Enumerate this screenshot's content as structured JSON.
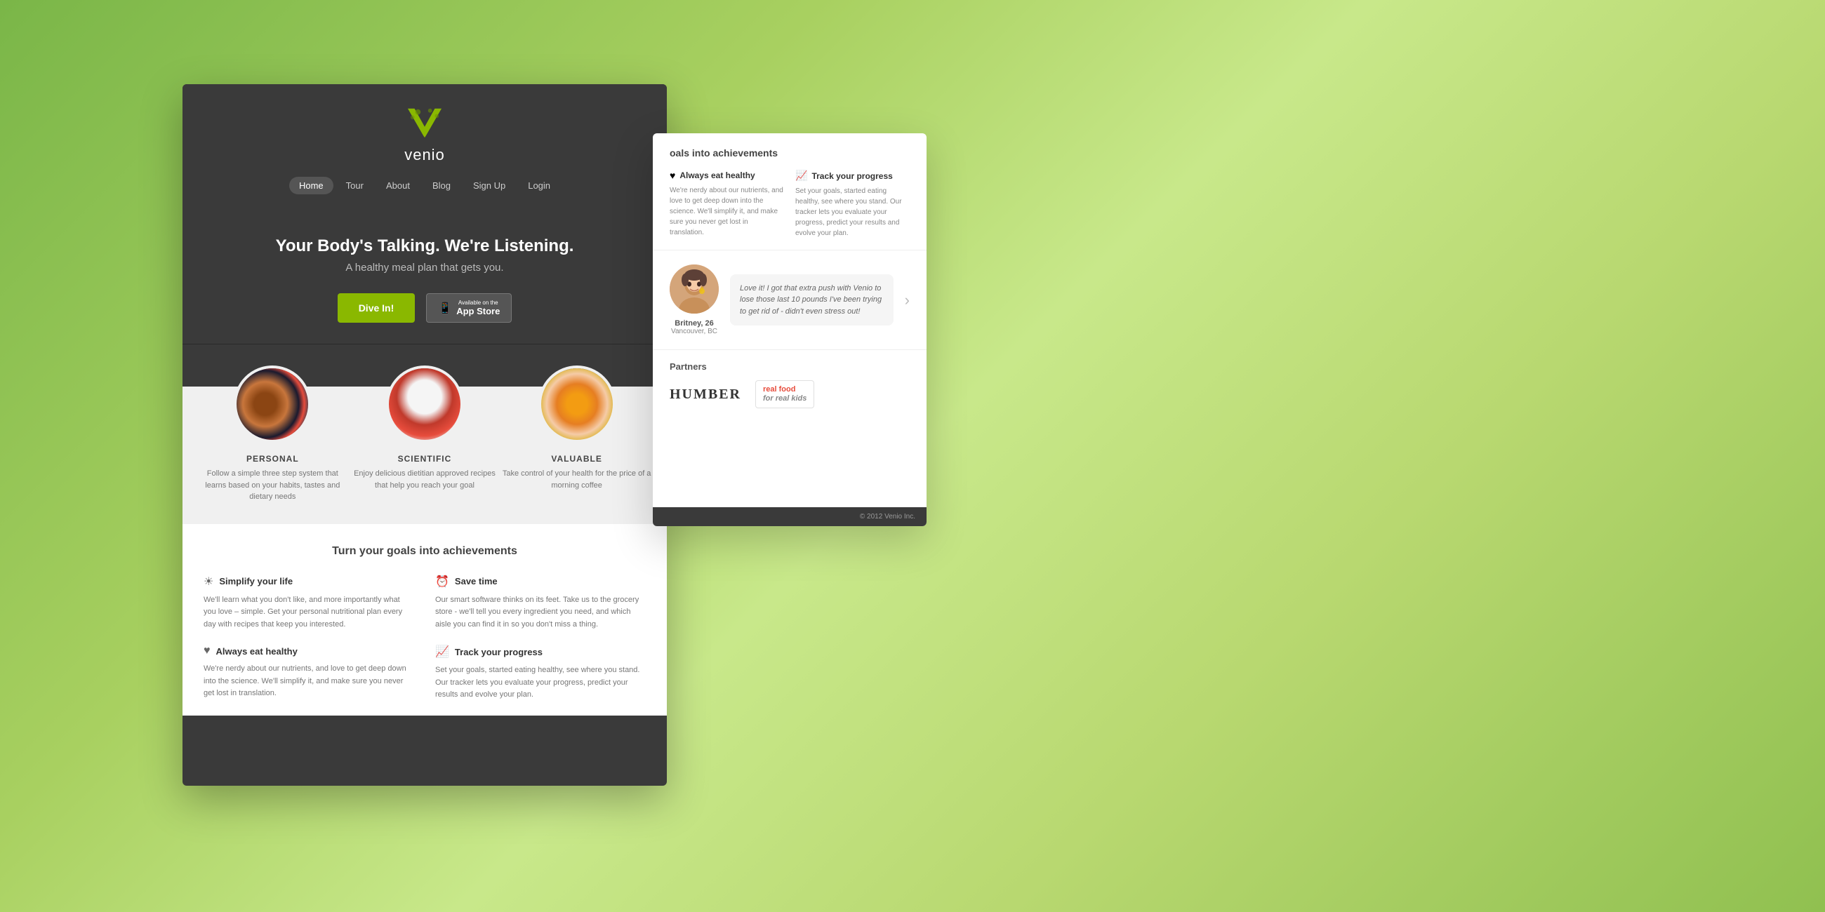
{
  "app": {
    "title": "venio",
    "logo_alt": "venio logo"
  },
  "nav": {
    "items": [
      {
        "label": "Home",
        "active": true
      },
      {
        "label": "Tour",
        "active": false
      },
      {
        "label": "About",
        "active": false
      },
      {
        "label": "Blog",
        "active": false
      },
      {
        "label": "Sign Up",
        "active": false
      },
      {
        "label": "Login",
        "active": false
      }
    ]
  },
  "hero": {
    "title": "Your Body's Talking. We're Listening.",
    "subtitle": "A healthy meal plan that gets you.",
    "btn_dive": "Dive In!",
    "btn_appstore_small": "Available on the",
    "btn_appstore_big": "App Store"
  },
  "features": [
    {
      "name": "PERSONAL",
      "desc": "Follow a simple three step system that learns based on your habits, tastes and dietary needs"
    },
    {
      "name": "SCIENTIFIC",
      "desc": "Enjoy delicious dietitian approved recipes that help you reach your goal"
    },
    {
      "name": "VALUABLE",
      "desc": "Take control of your health for the price of a morning coffee"
    }
  ],
  "goals_section": {
    "title": "Turn your goals into achievements",
    "items": [
      {
        "icon": "☀",
        "title": "Simplify your life",
        "desc": "We'll learn what you don't like, and more importantly what you love – simple. Get your personal nutritional plan every day with recipes that keep you interested."
      },
      {
        "icon": "⏰",
        "title": "Save time",
        "desc": "Our smart software thinks on its feet. Take us to the grocery store - we'll tell you every ingredient you need, and which aisle you can find it in so you don't miss a thing."
      },
      {
        "icon": "♥",
        "title": "Always eat healthy",
        "desc": "We're nerdy about our nutrients, and love to get deep down into the science. We'll simplify it, and make sure you never get lost in translation."
      },
      {
        "icon": "📈",
        "title": "Track your progress",
        "desc": "Set your goals, started eating healthy, see where you stand. Our tracker lets you evaluate your progress, predict your results and evolve your plan."
      }
    ]
  },
  "side_panel": {
    "achievements_title": "oals into achievements",
    "goals": [
      {
        "icon": "♥",
        "title": "Always eat healthy",
        "desc": "We're nerdy about our nutrients, and love to get deep down into the science. We'll simplify it, and make sure you never get lost in translation."
      },
      {
        "icon": "📈",
        "title": "Track your progress",
        "desc": "Set your goals, started eating healthy, see where you stand. Our tracker lets you evaluate your progress, predict your results and evolve your plan."
      }
    ],
    "testimonial": {
      "quote": "Love it! I got that extra push with Venio to lose those last 10 pounds I've been trying to get rid of - didn't even stress out!",
      "name": "Britney, 26",
      "location": "Vancouver, BC"
    },
    "partners_title": "Partners",
    "partners": [
      {
        "name": "HUMBER"
      },
      {
        "name": "real food for real kids"
      }
    ],
    "footer": "© 2012 Venio Inc."
  }
}
